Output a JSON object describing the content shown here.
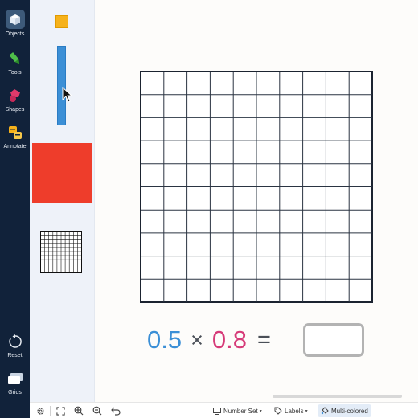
{
  "sidebar": {
    "objects_label": "Objects",
    "tools_label": "Tools",
    "shapes_label": "Shapes",
    "annotate_label": "Annotate",
    "reset_label": "Reset",
    "grids_label": "Grids"
  },
  "equation": {
    "left_value": "0.5",
    "times_symbol": "×",
    "right_value": "0.8",
    "equals_symbol": "="
  },
  "grid_board": {
    "rows": 10,
    "cols": 10
  },
  "bottom_bar": {
    "number_set_label": "Number Set",
    "labels_label": "Labels",
    "multi_colored_label": "Multi-colored"
  },
  "colors": {
    "toolbar": "#11223a",
    "left_value": "#3b8fd6",
    "right_value": "#d63a78",
    "orange_tile": "#f6b21b",
    "blue_bar": "#3b8fd6",
    "red_square": "#ee3d2b"
  },
  "icons": {
    "objects": "cube-icon",
    "tools": "marker-icon",
    "shapes": "shapes-icon",
    "annotate": "annotate-icon",
    "reset": "reset-icon",
    "grids": "grids-icon",
    "settings": "gear-icon",
    "fullscreen": "fullscreen-icon",
    "zoom_in": "zoom-in-icon",
    "zoom_out": "zoom-out-icon",
    "undo": "undo-icon",
    "cursor": "mouse-pointer-icon"
  }
}
